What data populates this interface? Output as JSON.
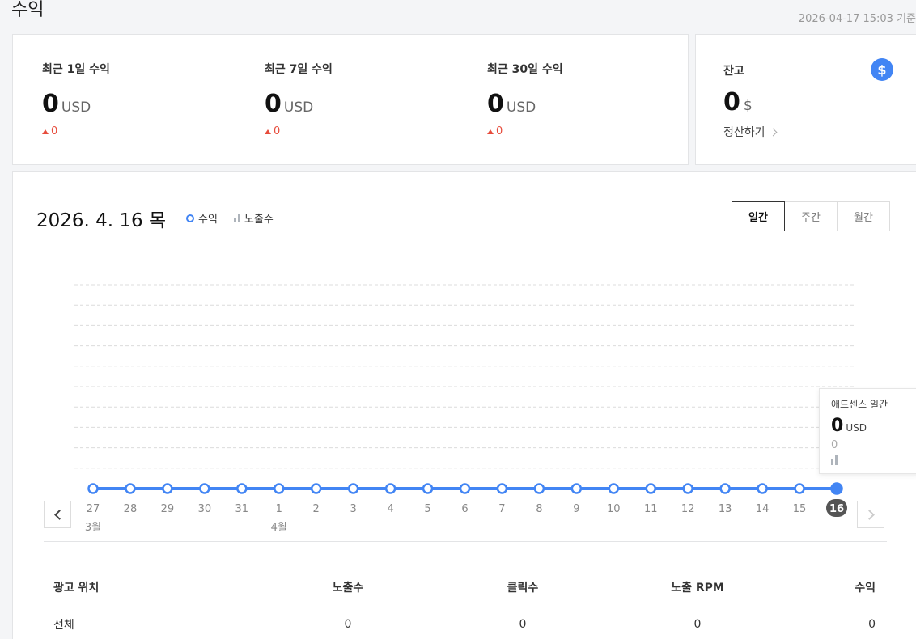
{
  "header": {
    "title": "수익",
    "timestamp": "2026-04-17 15:03 기준"
  },
  "summary": {
    "metrics": [
      {
        "label": "최근 1일 수익",
        "value": "0",
        "unit": "USD",
        "delta": "0"
      },
      {
        "label": "최근 7일 수익",
        "value": "0",
        "unit": "USD",
        "delta": "0"
      },
      {
        "label": "최근 30일 수익",
        "value": "0",
        "unit": "USD",
        "delta": "0"
      }
    ]
  },
  "balance": {
    "label": "잔고",
    "icon": "dollar-icon",
    "icon_glyph": "$",
    "value": "0",
    "unit": "$",
    "settle_label": "정산하기"
  },
  "chart": {
    "date_title": "2026. 4. 16 목",
    "legend": {
      "revenue": "수익",
      "impressions": "노출수"
    },
    "period_tabs": [
      "일간",
      "주간",
      "월간"
    ],
    "active_tab": "일간",
    "accent_color": "#4285f4",
    "tooltip": {
      "title": "애드센스 일간",
      "value": "0",
      "unit": "USD",
      "impressions": "0"
    }
  },
  "chart_data": {
    "type": "line",
    "x": [
      "27",
      "28",
      "29",
      "30",
      "31",
      "1",
      "2",
      "3",
      "4",
      "5",
      "6",
      "7",
      "8",
      "9",
      "10",
      "11",
      "12",
      "13",
      "14",
      "15",
      "16"
    ],
    "month_labels": [
      {
        "index": 0,
        "label": "3월"
      },
      {
        "index": 5,
        "label": "4월"
      }
    ],
    "series": [
      {
        "name": "수익",
        "values": [
          0,
          0,
          0,
          0,
          0,
          0,
          0,
          0,
          0,
          0,
          0,
          0,
          0,
          0,
          0,
          0,
          0,
          0,
          0,
          0,
          0
        ]
      },
      {
        "name": "노출수",
        "values": [
          0,
          0,
          0,
          0,
          0,
          0,
          0,
          0,
          0,
          0,
          0,
          0,
          0,
          0,
          0,
          0,
          0,
          0,
          0,
          0,
          0
        ]
      }
    ],
    "selected_index": 20,
    "grid": true
  },
  "table": {
    "headers": [
      "광고 위치",
      "노출수",
      "클릭수",
      "노출 RPM",
      "수익"
    ],
    "rows": [
      [
        "전체",
        "0",
        "0",
        "0",
        "0"
      ]
    ]
  }
}
